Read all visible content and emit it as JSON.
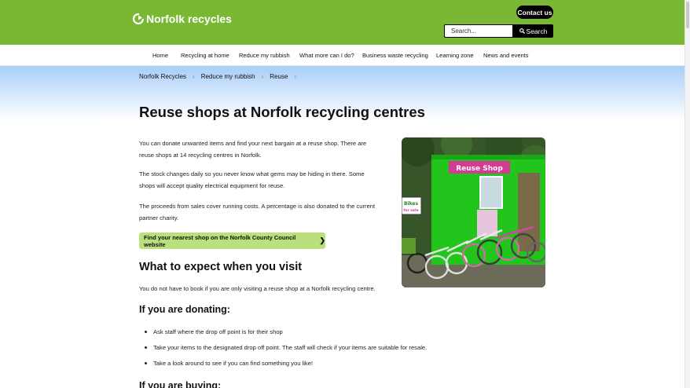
{
  "header": {
    "logo_text": "Norfolk recycles",
    "contact_label": "Contact us",
    "search_placeholder": "Search...",
    "search_button": "Search",
    "colors": {
      "brand_green": "#7ab833",
      "cta_green": "#b9e07d"
    }
  },
  "nav": {
    "items": [
      {
        "label": "Home"
      },
      {
        "label": "Recycling at home"
      },
      {
        "label": "Reduce my rubbish"
      },
      {
        "label": "What more can I do?"
      },
      {
        "label": "Business waste recycling"
      },
      {
        "label": "Learning zone"
      },
      {
        "label": "News and events"
      }
    ]
  },
  "breadcrumb": {
    "items": [
      {
        "label": "Norfolk Recycles"
      },
      {
        "label": "Reduce my rubbish"
      },
      {
        "label": "Reuse"
      }
    ]
  },
  "main": {
    "title": "Reuse shops at Norfolk recycling centres",
    "paragraphs": [
      {
        "line1": "You can donate unwanted items and find your next bargain at a reuse shop. There are",
        "line2": "reuse shops at 14 recycling centres in Norfolk."
      },
      {
        "line1": "The stock changes daily so you never know what gems may be hiding in there. Some",
        "line2": "shops will accept quality electrical equipment for reuse."
      },
      {
        "line1": "The proceeds from sales cover running costs. A percentage is also donated to the current",
        "line2": "partner charity."
      }
    ],
    "cta_label": "Find your nearest shop on the Norfolk County Council website",
    "what_to_expect_heading": "What to expect when you visit",
    "what_to_expect_text": "You do not have to book if you are only visiting a reuse shop at a Norfolk recycling centre.",
    "donating_heading": "If you are donating:",
    "donating_items": [
      "Ask staff where the drop off point is for their shop",
      "Take your items to the designated drop off point. The staff will check if your items are suitable for resale.",
      "Take a look around to see if you can find something you like!"
    ],
    "buying_heading": "If you are buying:"
  },
  "photo": {
    "shop_sign": "Reuse Shop",
    "bikes_sign_line1": "Bikes",
    "bikes_sign_line2": "for sale"
  }
}
